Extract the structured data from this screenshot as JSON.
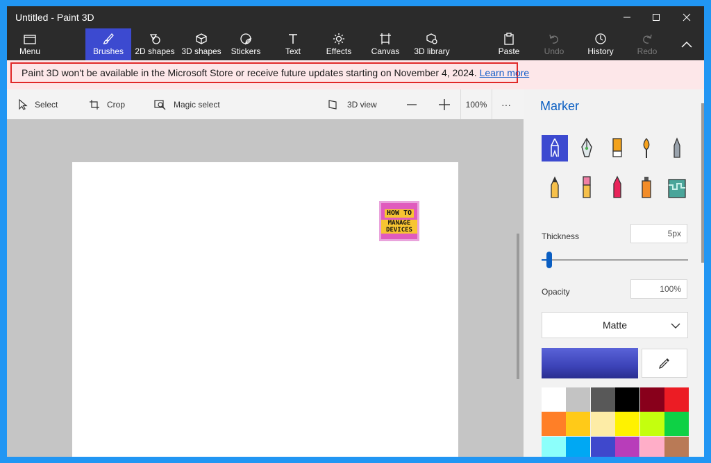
{
  "window": {
    "title": "Untitled - Paint 3D"
  },
  "ribbon": {
    "menu": "Menu",
    "brushes": "Brushes",
    "shapes2d": "2D shapes",
    "shapes3d": "3D shapes",
    "stickers": "Stickers",
    "text": "Text",
    "effects": "Effects",
    "canvas": "Canvas",
    "library3d": "3D library",
    "paste": "Paste",
    "undo": "Undo",
    "history": "History",
    "redo": "Redo"
  },
  "banner": {
    "message": "Paint 3D won't be available in the Microsoft Store or receive future updates starting on November 4, 2024.",
    "link": "Learn more"
  },
  "toolbar": {
    "select": "Select",
    "crop": "Crop",
    "magic_select": "Magic select",
    "view3d": "3D view",
    "zoom": "100%",
    "more": "···"
  },
  "canvas": {
    "logo_line1": "HOW TO",
    "logo_line2": "MANAGE DEVICES"
  },
  "panel": {
    "title": "Marker",
    "thickness_label": "Thickness",
    "thickness_value": "5px",
    "thickness_slider_fraction": 0.05,
    "opacity_label": "Opacity",
    "opacity_value": "100%",
    "finish": "Matte",
    "current_color": "#4046c4",
    "brushes": [
      "marker-icon",
      "calligraphy-pen-icon",
      "oil-brush-icon",
      "watercolor-icon",
      "pixel-pen-icon",
      "pencil-icon",
      "eraser-icon",
      "crayon-icon",
      "spray-can-icon",
      "fill-bucket-icon"
    ],
    "palette": [
      "#ffffff",
      "#c3c3c3",
      "#585858",
      "#000000",
      "#88001b",
      "#ec1c24",
      "#ff7f27",
      "#ffca18",
      "#fdeca6",
      "#fff200",
      "#c4ff0e",
      "#0ed145",
      "#8cfffb",
      "#00a8f3",
      "#3f48cc",
      "#b83dba",
      "#ffaec8",
      "#b97a56"
    ]
  }
}
